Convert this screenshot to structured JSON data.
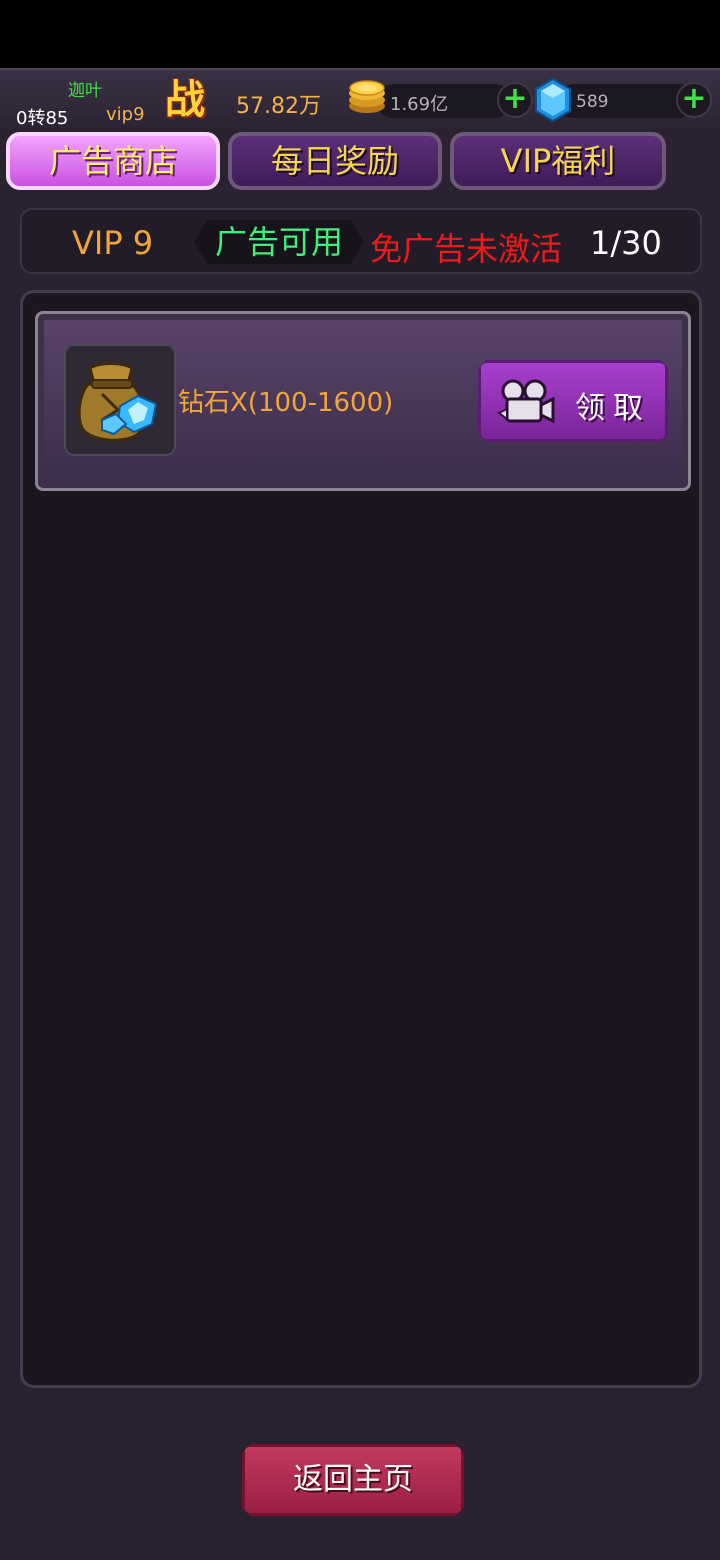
{
  "header": {
    "player_name": "迦叶",
    "rebirth": "0转85",
    "vip": "vip9",
    "zhan_glyph": "战",
    "power": "57.82万",
    "gold": "1.69亿",
    "gold_icon": "gold-coins-icon",
    "gems": "589",
    "gem_icon": "blue-diamond-icon",
    "plus": "+"
  },
  "tabs": [
    {
      "label": "广告商店",
      "active": true
    },
    {
      "label": "每日奖励",
      "active": false
    },
    {
      "label": "VIP福利",
      "active": false
    }
  ],
  "status": {
    "vip_level": "VIP 9",
    "ad_available": "广告可用",
    "no_ad": "免广告未激活",
    "count": "1/30"
  },
  "items": [
    {
      "icon": "diamond-bag-icon",
      "name": "钻石X(100-1600)",
      "action_icon": "video-camera-icon",
      "action_label": "领取"
    }
  ],
  "footer": {
    "home_label": "返回主页"
  },
  "colors": {
    "accent_orange": "#f3a53a",
    "green": "#3fe04a",
    "red": "#ee1a1a",
    "tab_active": "#c851e2",
    "tab_inactive": "#4f2669",
    "home_button": "#b02a50"
  }
}
